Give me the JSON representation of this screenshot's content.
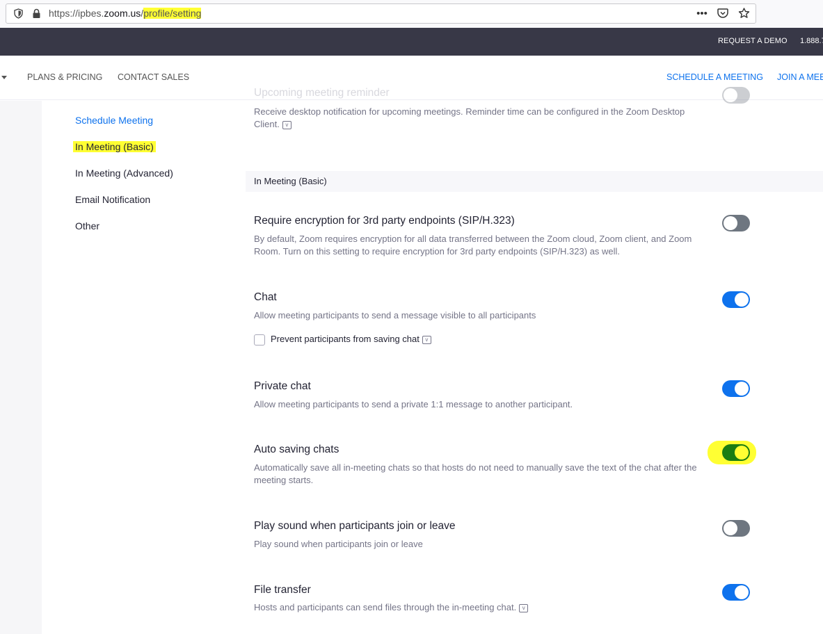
{
  "browser": {
    "url_prefix": "https://ipbes.",
    "url_domain": "zoom.us",
    "url_path_a": "/",
    "url_path_hl": "profile/setting",
    "more_icon": "more-horizontal-icon",
    "pocket_icon": "pocket-icon",
    "bookmark_icon": "star-icon"
  },
  "topbar": {
    "request_demo": "REQUEST A DEMO",
    "phone": "1.888.7"
  },
  "nav": {
    "plans": "PLANS & PRICING",
    "contact": "CONTACT SALES",
    "schedule": "SCHEDULE A MEETING",
    "join": "JOIN A MEE"
  },
  "sidebar": {
    "items": [
      {
        "label": "Schedule Meeting"
      },
      {
        "label": "In Meeting (Basic)"
      },
      {
        "label": "In Meeting (Advanced)"
      },
      {
        "label": "Email Notification"
      },
      {
        "label": "Other"
      }
    ]
  },
  "content": {
    "upcoming": {
      "title": "Upcoming meeting reminder",
      "desc": "Receive desktop notification for upcoming meetings. Reminder time can be configured in the Zoom Desktop Client."
    },
    "section_header": "In Meeting (Basic)",
    "settings": [
      {
        "title": "Require encryption for 3rd party endpoints (SIP/H.323)",
        "desc": "By default, Zoom requires encryption for all data transferred between the Zoom cloud, Zoom client, and Zoom Room. Turn on this setting to require encryption for 3rd party endpoints (SIP/H.323) as well.",
        "enabled": false
      },
      {
        "title": "Chat",
        "desc": "Allow meeting participants to send a message visible to all participants",
        "enabled": true
      },
      {
        "title": "Private chat",
        "desc": "Allow meeting participants to send a private 1:1 message to another participant.",
        "enabled": true
      },
      {
        "title": "Auto saving chats",
        "desc": "Automatically save all in-meeting chats so that hosts do not need to manually save the text of the chat after the meeting starts.",
        "enabled": true
      },
      {
        "title": "Play sound when participants join or leave",
        "desc": "Play sound when participants join or leave",
        "enabled": false
      },
      {
        "title": "File transfer",
        "desc": "Hosts and participants can send files through the in-meeting chat.",
        "enabled": true
      }
    ],
    "prevent_saving_chat": "Prevent participants from saving chat"
  },
  "colors": {
    "accent": "#0e72ed",
    "highlight": "#ffff33",
    "topbar": "#383847"
  }
}
